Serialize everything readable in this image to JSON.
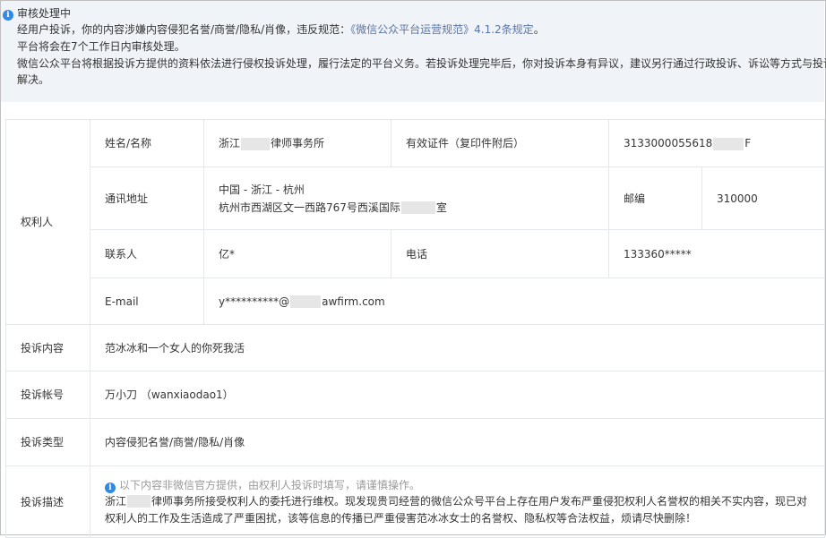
{
  "notice": {
    "title": "审核处理中",
    "line1_prefix": "经用户投诉，你的内容涉嫌内容侵犯名誉/商誉/隐私/肖像，违反规范：",
    "line1_link": "《微信公众平台运营规范》4.1.2条规定",
    "line1_suffix": "。",
    "line2": "平台将会在7个工作日内审核处理。",
    "line3": "微信公众平台将根据投诉方提供的资料依法进行侵权投诉处理，履行法定的平台义务。若投诉处理完毕后，你对投诉本身有异议，建议另行通过行政投诉、诉讼等方式与投诉方",
    "line4": "解决。"
  },
  "rights_holder": {
    "section_label": "权利人",
    "name_label": "姓名/名称",
    "name_prefix": "浙江",
    "name_suffix": "律师事务所",
    "cert_label": "有效证件（复印件附后）",
    "cert_prefix": "3133000055618",
    "cert_suffix": "F",
    "address_label": "通讯地址",
    "address_line1": "中国 - 浙江 - 杭州",
    "address_line2_prefix": "杭州市西湖区文一西路767号西溪国际",
    "address_line2_suffix": "室",
    "postcode_label": "邮编",
    "postcode": "310000",
    "contact_label": "联系人",
    "contact": "亿*",
    "phone_label": "电话",
    "phone": "133360*****",
    "email_label": "E-mail",
    "email_prefix": "y**********@",
    "email_suffix": "awfirm.com"
  },
  "complaint": {
    "content_label": "投诉内容",
    "content": "范冰冰和一个女人的你死我活",
    "account_label": "投诉帐号",
    "account": "万小刀 （wanxiaodao1）",
    "type_label": "投诉类型",
    "type": "内容侵犯名誉/商誉/隐私/肖像",
    "desc_label": "投诉描述",
    "desc_tip": "以下内容非微信官方提供，由权利人投诉时填写，请谨慎操作。",
    "desc_prefix": "浙江",
    "desc_body": "律师事务所接受权利人的委托进行维权。现发现贵司经营的微信公众号平台上存在用户发布严重侵犯权利人名誉权的相关不实内容，现已对权利人的工作及生活造成了严重困扰，该等信息的传播已严重侵害范冰冰女士的名誉权、隐私权等合法权益，烦请尽快删除！"
  }
}
